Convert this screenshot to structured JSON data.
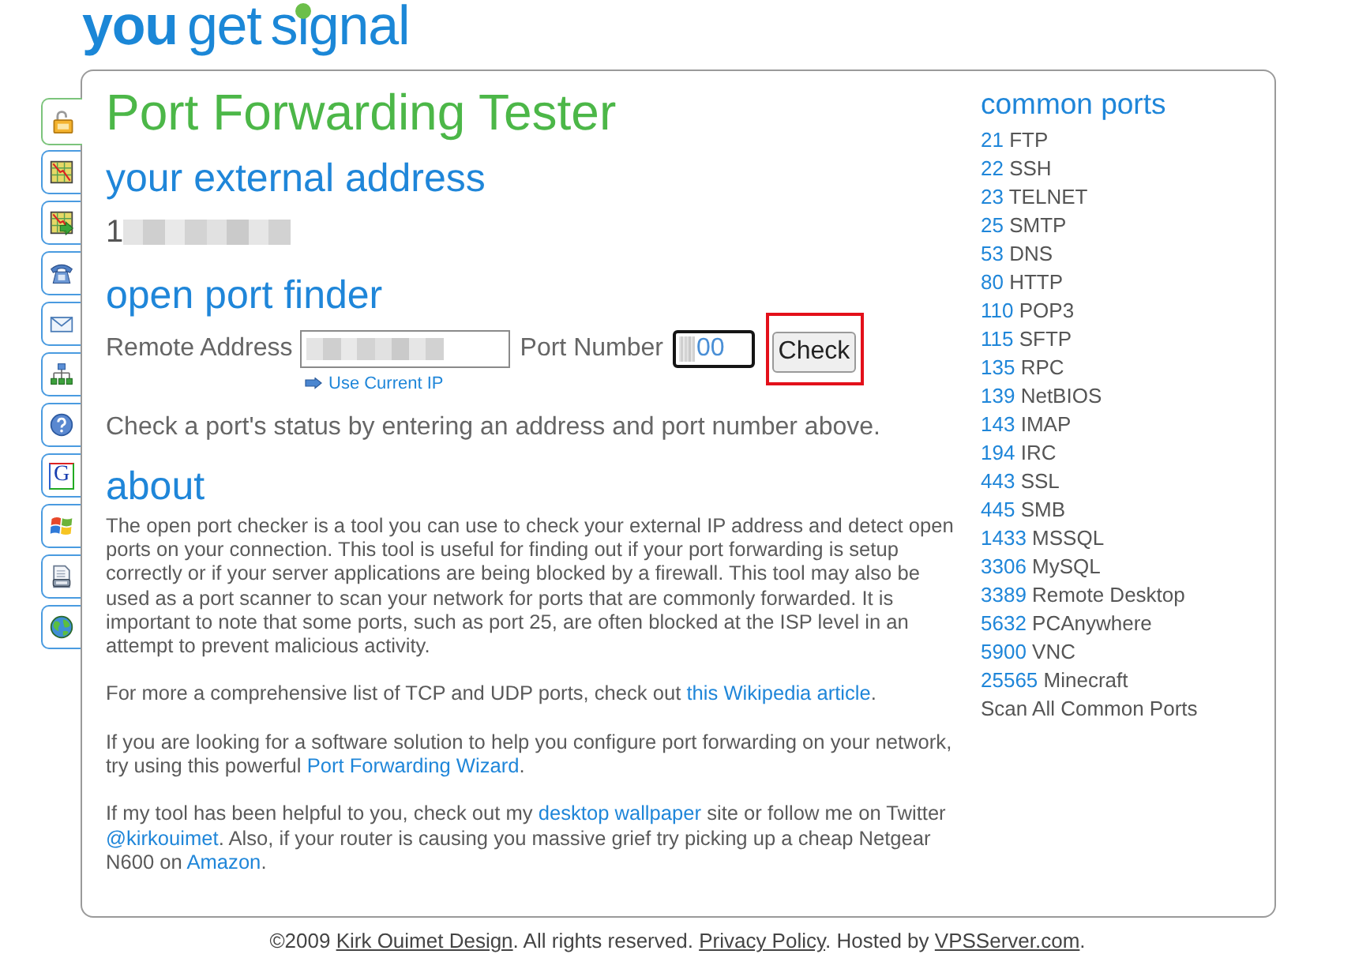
{
  "logo": {
    "words": [
      {
        "text": "you",
        "bold": true
      },
      {
        "text": "get",
        "bold": false
      },
      {
        "text": "signal",
        "bold": false
      }
    ]
  },
  "side_tabs": [
    {
      "kind": "padlock",
      "selected": true
    },
    {
      "kind": "chart",
      "selected": false
    },
    {
      "kind": "chart-arrow",
      "selected": false
    },
    {
      "kind": "telephone",
      "selected": false
    },
    {
      "kind": "envelope",
      "selected": false
    },
    {
      "kind": "network",
      "selected": false
    },
    {
      "kind": "help",
      "selected": false
    },
    {
      "kind": "letter",
      "label": "G",
      "selected": false
    },
    {
      "kind": "flag",
      "selected": false
    },
    {
      "kind": "document",
      "selected": false
    },
    {
      "kind": "globe",
      "selected": false
    }
  ],
  "title": "Port Forwarding Tester",
  "external_address": {
    "heading": "your external address",
    "visible_text": "1",
    "redacted": true
  },
  "port_finder": {
    "heading": "open port finder",
    "remote_address": {
      "label": "Remote Address",
      "redacted": true
    },
    "port_number": {
      "label": "Port Number",
      "value": "00",
      "redacted": true
    },
    "check_button": {
      "label": "Check",
      "highlighted": true
    },
    "use_current_ip": "Use Current IP",
    "status": "Check a port's status by entering an address and port number above."
  },
  "about": {
    "heading": "about",
    "paragraphs": [
      [
        {
          "kind": "text",
          "text": "The open port checker is a tool you can use to check your external IP address and detect open ports on your connection. This tool is useful for finding out if your port forwarding is setup correctly or if your server applications are being blocked by a firewall. This tool may also be used as a port scanner to scan your network for ports that are commonly forwarded. It is important to note that some ports, such as port 25, are often blocked at the ISP level in an attempt to prevent malicious activity."
        }
      ],
      [
        {
          "kind": "text",
          "text": "For more a comprehensive list of TCP and UDP ports, check out "
        },
        {
          "kind": "link",
          "text": "this Wikipedia article"
        },
        {
          "kind": "text",
          "text": "."
        }
      ],
      [
        {
          "kind": "text",
          "text": "If you are looking for a software solution to help you configure port forwarding on your network, try using this powerful "
        },
        {
          "kind": "link",
          "text": "Port Forwarding Wizard"
        },
        {
          "kind": "text",
          "text": "."
        }
      ],
      [
        {
          "kind": "text",
          "text": "If my tool has been helpful to you, check out my "
        },
        {
          "kind": "link",
          "text": "desktop wallpaper"
        },
        {
          "kind": "text",
          "text": " site or follow me on Twitter "
        },
        {
          "kind": "link",
          "text": "@kirkouimet"
        },
        {
          "kind": "text",
          "text": ". Also, if your router is causing you massive grief try picking up a cheap Netgear N600 on "
        },
        {
          "kind": "link",
          "text": "Amazon"
        },
        {
          "kind": "text",
          "text": "."
        }
      ]
    ]
  },
  "common_ports": {
    "heading": "common ports",
    "items": [
      {
        "port": "21",
        "service": "FTP"
      },
      {
        "port": "22",
        "service": "SSH"
      },
      {
        "port": "23",
        "service": "TELNET"
      },
      {
        "port": "25",
        "service": "SMTP"
      },
      {
        "port": "53",
        "service": "DNS"
      },
      {
        "port": "80",
        "service": "HTTP"
      },
      {
        "port": "110",
        "service": "POP3"
      },
      {
        "port": "115",
        "service": "SFTP"
      },
      {
        "port": "135",
        "service": "RPC"
      },
      {
        "port": "139",
        "service": "NetBIOS"
      },
      {
        "port": "143",
        "service": "IMAP"
      },
      {
        "port": "194",
        "service": "IRC"
      },
      {
        "port": "443",
        "service": "SSL"
      },
      {
        "port": "445",
        "service": "SMB"
      },
      {
        "port": "1433",
        "service": "MSSQL"
      },
      {
        "port": "3306",
        "service": "MySQL"
      },
      {
        "port": "3389",
        "service": "Remote Desktop"
      },
      {
        "port": "5632",
        "service": "PCAnywhere"
      },
      {
        "port": "5900",
        "service": "VNC"
      },
      {
        "port": "25565",
        "service": "Minecraft"
      }
    ],
    "scan_all": "Scan All Common Ports"
  },
  "footer": [
    {
      "kind": "text",
      "text": "©2009 "
    },
    {
      "kind": "link",
      "text": "Kirk Ouimet Design"
    },
    {
      "kind": "text",
      "text": ". All rights reserved. "
    },
    {
      "kind": "link",
      "text": "Privacy Policy"
    },
    {
      "kind": "text",
      "text": ". Hosted by "
    },
    {
      "kind": "link",
      "text": "VPSServer.com"
    },
    {
      "kind": "text",
      "text": "."
    }
  ]
}
